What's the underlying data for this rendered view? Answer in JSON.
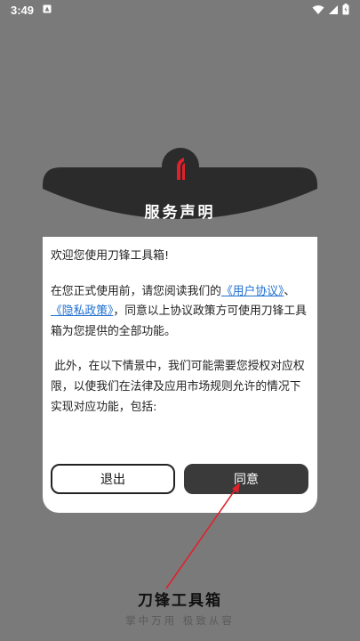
{
  "status_bar": {
    "time": "3:49"
  },
  "dialog": {
    "title": "服务声明",
    "greeting": "欢迎您使用刀锋工具箱!",
    "para1_before": "在您正式使用前，请您阅读我们的",
    "link_user_agreement": "《用户协议》",
    "separator": "、",
    "link_privacy_policy": "《隐私政策》",
    "para1_after": "，同意以上协议政策方可使用刀锋工具箱为您提供的全部功能。",
    "para2": "此外，在以下情景中，我们可能需要您授权对应权限，以使我们在法律及应用市场规则允许的情况下实现对应功能，包括:",
    "exit_label": "退出",
    "agree_label": "同意"
  },
  "brand": {
    "name": "刀锋工具箱",
    "slogan": "掌中万用  极致从容"
  },
  "colors": {
    "overlay": "#7a7a7a",
    "header": "#2b2b2b",
    "accent_red": "#e0212b",
    "link": "#1e6fd0"
  },
  "icons": {
    "notification": "notification-icon",
    "wifi": "wifi-icon",
    "signal": "signal-icon",
    "battery": "battery-icon",
    "logo": "app-logo-icon"
  }
}
